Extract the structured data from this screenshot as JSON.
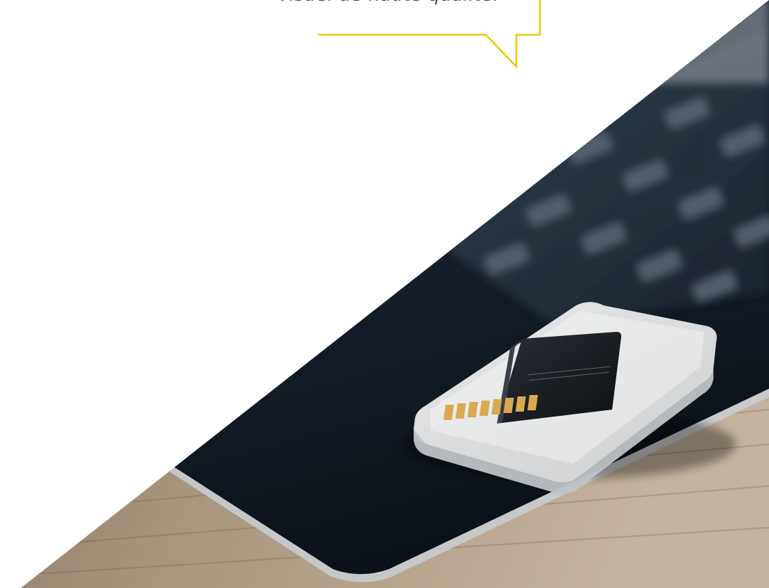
{
  "quote": {
    "text": "visuel de haute qualité."
  },
  "colors": {
    "accent": "#f2c400",
    "background": "#ffffff",
    "text": "#4a4a4a",
    "laptop": "#111a26",
    "desk": "#9c8a74"
  },
  "photo": {
    "subject": "sd-card-on-case-on-laptop"
  }
}
